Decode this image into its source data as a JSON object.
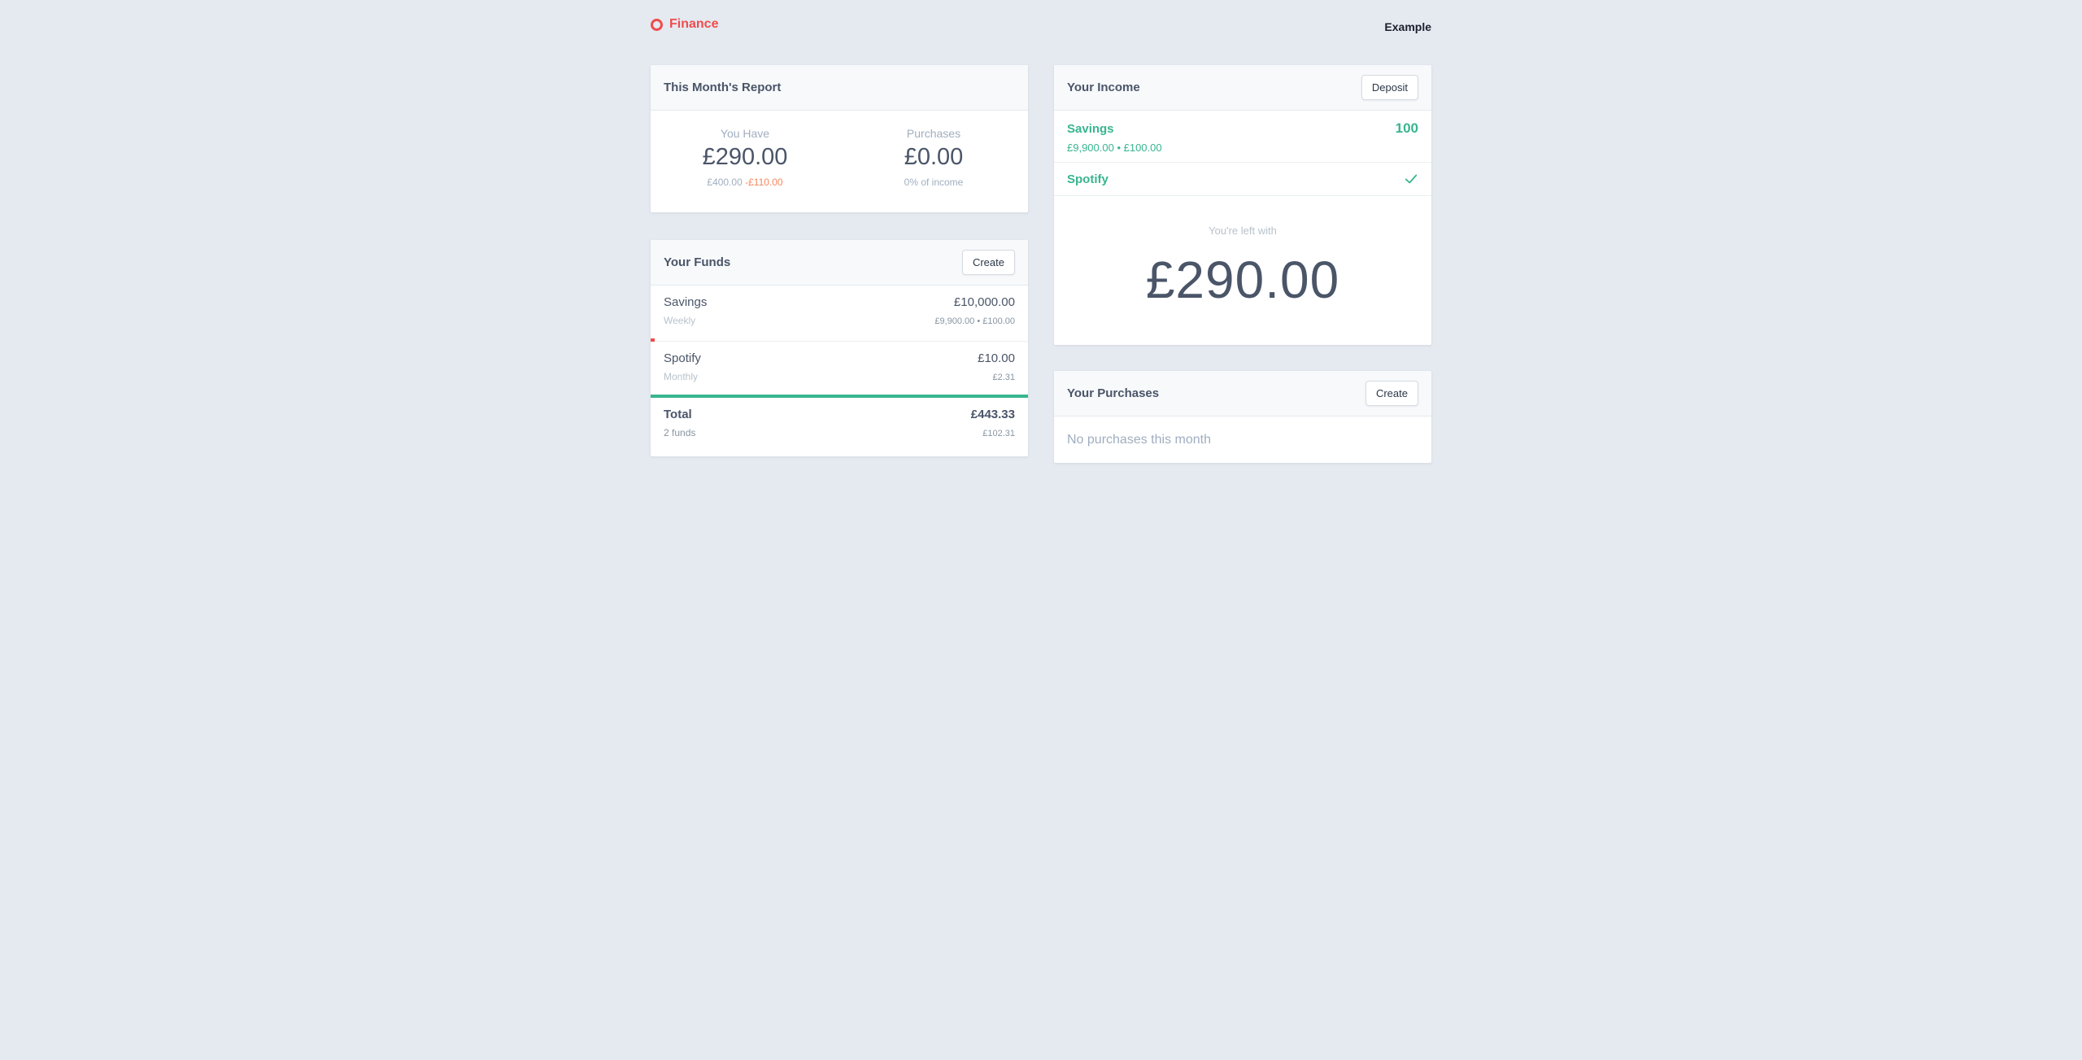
{
  "header": {
    "brand": "Finance",
    "user": "Example"
  },
  "report": {
    "title": "This Month's Report",
    "you_have_label": "You Have",
    "you_have_value": "£290.00",
    "income_part": "£400.00",
    "deduction_part": "-£110.00",
    "purchases_label": "Purchases",
    "purchases_value": "£0.00",
    "purchases_sub": "0% of income"
  },
  "funds": {
    "title": "Your Funds",
    "create_label": "Create",
    "items": [
      {
        "name": "Savings",
        "amount": "£10,000.00",
        "frequency": "Weekly",
        "meta": "£9,900.00 • £100.00",
        "progress": 0.01,
        "bar_color": "#ef4d4d"
      },
      {
        "name": "Spotify",
        "amount": "£10.00",
        "frequency": "Monthly",
        "meta": "£2.31",
        "progress": 1.0,
        "bar_color": "#38b58f"
      }
    ],
    "total": {
      "label": "Total",
      "amount": "£443.33",
      "count": "2 funds",
      "meta": "£102.31"
    }
  },
  "income": {
    "title": "Your Income",
    "deposit_label": "Deposit",
    "items": [
      {
        "name": "Savings",
        "sub": "£9,900.00 • £100.00",
        "value": "100"
      },
      {
        "name": "Spotify",
        "icon": "check-icon"
      }
    ],
    "left_label": "You're left with",
    "left_value": "£290.00"
  },
  "purchases": {
    "title": "Your Purchases",
    "create_label": "Create",
    "empty": "No purchases this month"
  },
  "colors": {
    "accent_red": "#ef4d4d",
    "accent_green": "#38b58f",
    "background": "#e5e9f0"
  }
}
